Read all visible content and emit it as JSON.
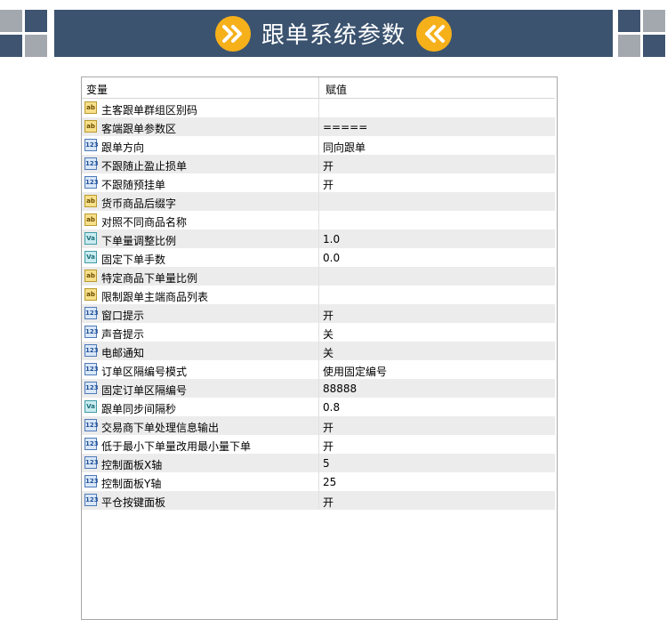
{
  "banner": {
    "title": "跟单系统参数",
    "left_icon": "double-chevron-right-icon",
    "right_icon": "double-chevron-left-icon",
    "colors": {
      "banner_bg": "#3b536f",
      "accent": "#f6b01a"
    }
  },
  "table": {
    "col_variable": "变量",
    "col_value": "赋值",
    "rows": [
      {
        "type": "ab",
        "name": "主客跟单群组区别码",
        "value": ""
      },
      {
        "type": "ab",
        "name": "客端跟单参数区",
        "value": "====="
      },
      {
        "type": "123",
        "name": "跟单方向",
        "value": "同向跟单"
      },
      {
        "type": "123",
        "name": "不跟随止盈止损单",
        "value": "开"
      },
      {
        "type": "123",
        "name": "不跟随预挂单",
        "value": "开"
      },
      {
        "type": "ab",
        "name": "货币商品后缀字",
        "value": ""
      },
      {
        "type": "ab",
        "name": "对照不同商品名称",
        "value": ""
      },
      {
        "type": "va",
        "name": "下单量调整比例",
        "value": "1.0"
      },
      {
        "type": "va",
        "name": "固定下单手数",
        "value": "0.0"
      },
      {
        "type": "ab",
        "name": "特定商品下单量比例",
        "value": ""
      },
      {
        "type": "ab",
        "name": "限制跟单主端商品列表",
        "value": ""
      },
      {
        "type": "123",
        "name": "窗口提示",
        "value": "开"
      },
      {
        "type": "123",
        "name": "声音提示",
        "value": "关"
      },
      {
        "type": "123",
        "name": "电邮通知",
        "value": "关"
      },
      {
        "type": "123",
        "name": "订单区隔编号模式",
        "value": "使用固定编号"
      },
      {
        "type": "123",
        "name": "固定订单区隔编号",
        "value": "88888"
      },
      {
        "type": "va",
        "name": "跟单同步间隔秒",
        "value": "0.8"
      },
      {
        "type": "123",
        "name": "交易商下单处理信息输出",
        "value": "开"
      },
      {
        "type": "123",
        "name": "低于最小下单量改用最小量下单",
        "value": "开"
      },
      {
        "type": "123",
        "name": "控制面板X轴",
        "value": "5"
      },
      {
        "type": "123",
        "name": "控制面板Y轴",
        "value": "25"
      },
      {
        "type": "123",
        "name": "平仓按键面板",
        "value": "开"
      }
    ]
  }
}
